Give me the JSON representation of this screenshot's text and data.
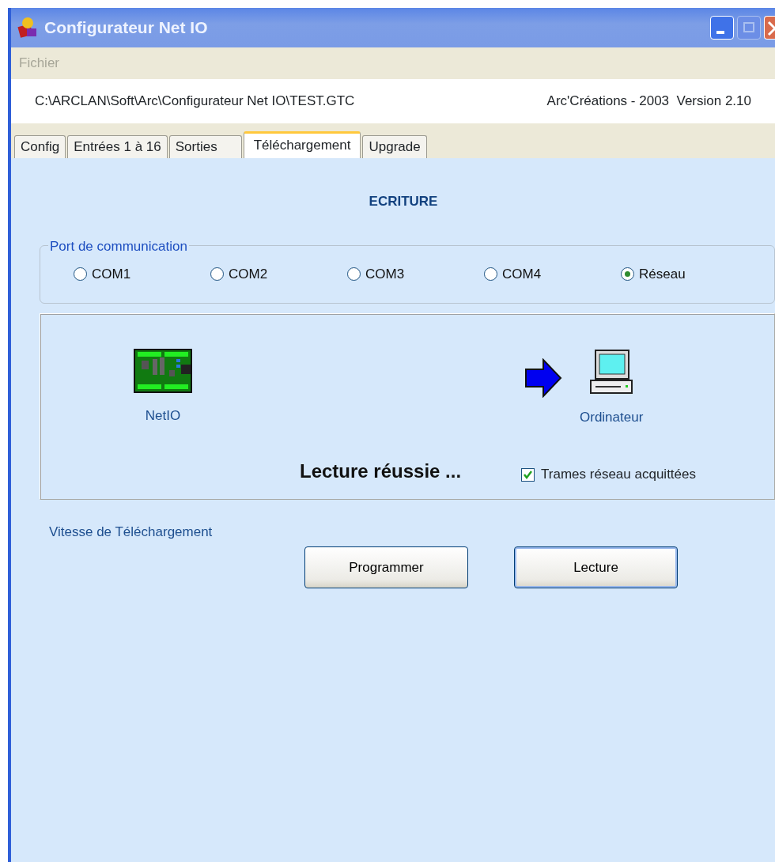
{
  "window": {
    "title": "Configurateur Net IO"
  },
  "menu": [
    {
      "label": "Fichier",
      "disabled": true
    }
  ],
  "path_bar": {
    "path": "C:\\ARCLAN\\Soft\\Arc\\Configurateur Net IO\\TEST.GTC",
    "version": "Arc'Créations - 2003  Version 2.10"
  },
  "tabs": [
    {
      "label": "Config",
      "selected": false
    },
    {
      "label": "Entrées 1 à 16",
      "selected": false
    },
    {
      "label": "Sorties",
      "selected": false
    },
    {
      "label": "Téléchargement",
      "selected": true
    },
    {
      "label": "Upgrade",
      "selected": false
    }
  ],
  "panel": {
    "heading": "ECRITURE",
    "port_group": {
      "legend": "Port de communication",
      "options": [
        {
          "label": "COM1",
          "selected": false
        },
        {
          "label": "COM2",
          "selected": false
        },
        {
          "label": "COM3",
          "selected": false
        },
        {
          "label": "COM4",
          "selected": false
        },
        {
          "label": "Réseau",
          "selected": true
        }
      ]
    },
    "transfer": {
      "source": "NetIO",
      "target": "Ordinateur",
      "status": "Lecture réussie ...",
      "ack": {
        "label": "Trames réseau acquittées",
        "checked": true
      }
    },
    "speed_label": "Vitesse de Téléchargement",
    "buttons": [
      {
        "label": "Programmer",
        "default": false
      },
      {
        "label": "Lecture",
        "default": true
      }
    ]
  }
}
